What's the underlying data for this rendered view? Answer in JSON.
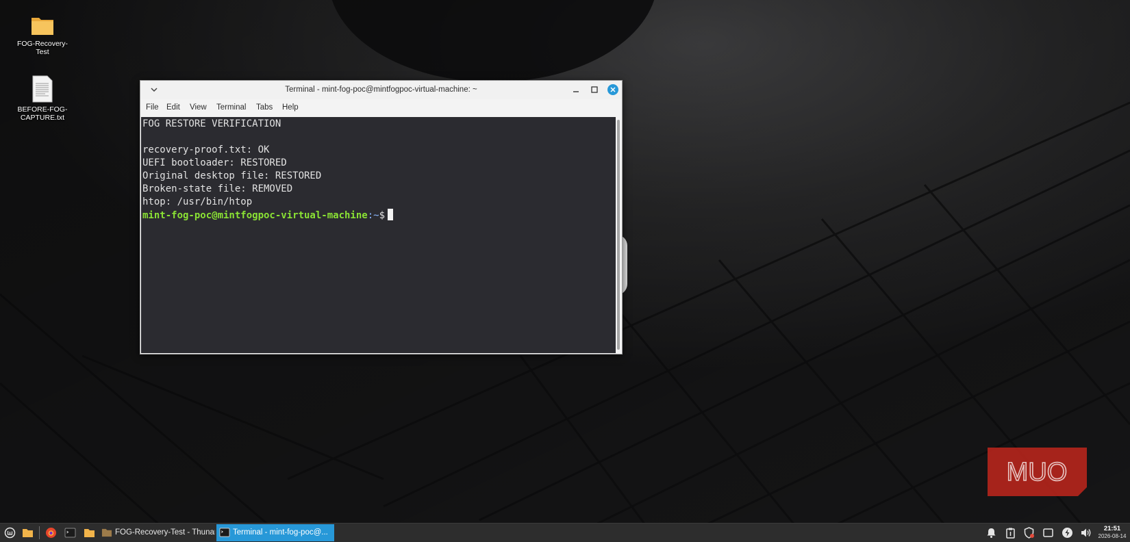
{
  "desktop": {
    "icons": [
      {
        "label": "FOG-Recovery-\nTest",
        "icon": "folder-icon"
      },
      {
        "label": "BEFORE-FOG-\nCAPTURE.txt",
        "icon": "text-file-icon"
      }
    ]
  },
  "terminal_window": {
    "title": "Terminal - mint-fog-poc@mintfogpoc-virtual-machine: ~",
    "menu": [
      "File",
      "Edit",
      "View",
      "Terminal",
      "Tabs",
      "Help"
    ],
    "lines": [
      "FOG RESTORE VERIFICATION",
      "",
      "recovery-proof.txt: OK",
      "UEFI bootloader: RESTORED",
      "Original desktop file: RESTORED",
      "Broken-state file: REMOVED",
      "htop: /usr/bin/htop"
    ],
    "prompt": {
      "user_host": "mint-fog-poc@mintfogpoc-virtual-machine",
      "path": ":~",
      "symbol": "$"
    }
  },
  "watermark": "MUO",
  "taskbar": {
    "tasks": [
      {
        "label": "FOG-Recovery-Test - Thunar",
        "icon": "folder-icon"
      },
      {
        "label": "Terminal - mint-fog-poc@...",
        "icon": "terminal-icon",
        "active": true
      }
    ],
    "tray_icons": [
      "bell-icon",
      "clipboard-icon",
      "shield-update-icon",
      "window-icon",
      "power-icon",
      "volume-icon"
    ],
    "clock": {
      "time": "21:51",
      "date": "2026-08-14"
    }
  },
  "colors": {
    "accent": "#2798d8",
    "prompt_user": "#8ae234",
    "terminal_bg": "#2b2b30",
    "close_button": "#2798d8"
  }
}
